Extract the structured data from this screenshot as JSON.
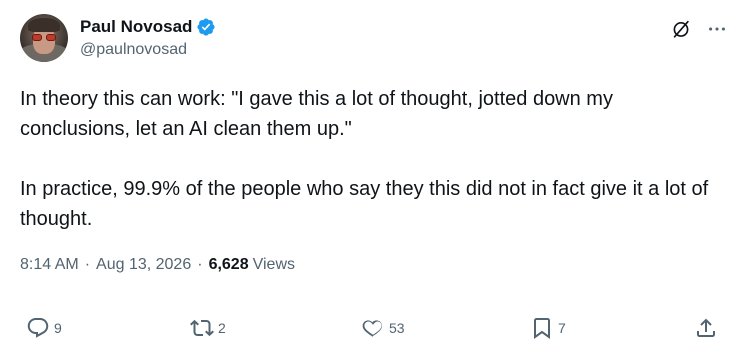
{
  "author": {
    "display_name": "Paul Novosad",
    "handle": "@paulnovosad",
    "verified": true,
    "verified_color": "#1d9bf0"
  },
  "tweet": {
    "paragraphs": [
      "In theory this can work: \"I gave this a lot of thought, jotted down my conclusions, let an AI clean them up.\"",
      "In practice, 99.9% of the people who say they this did not in fact give it a lot of thought."
    ],
    "time": "8:14 AM",
    "separator": "·",
    "date": "Aug 13, 2026",
    "views_count": "6,628",
    "views_label": "Views"
  },
  "actions": {
    "replies": "9",
    "reposts": "2",
    "likes": "53",
    "bookmarks": "7"
  },
  "icons": {
    "top": [
      "grok-icon",
      "more-icon"
    ],
    "actions": [
      "reply-icon",
      "repost-icon",
      "like-icon",
      "bookmark-icon",
      "share-icon"
    ]
  },
  "colors": {
    "text_primary": "#0f1419",
    "text_secondary": "#536471",
    "accent": "#1d9bf0"
  }
}
